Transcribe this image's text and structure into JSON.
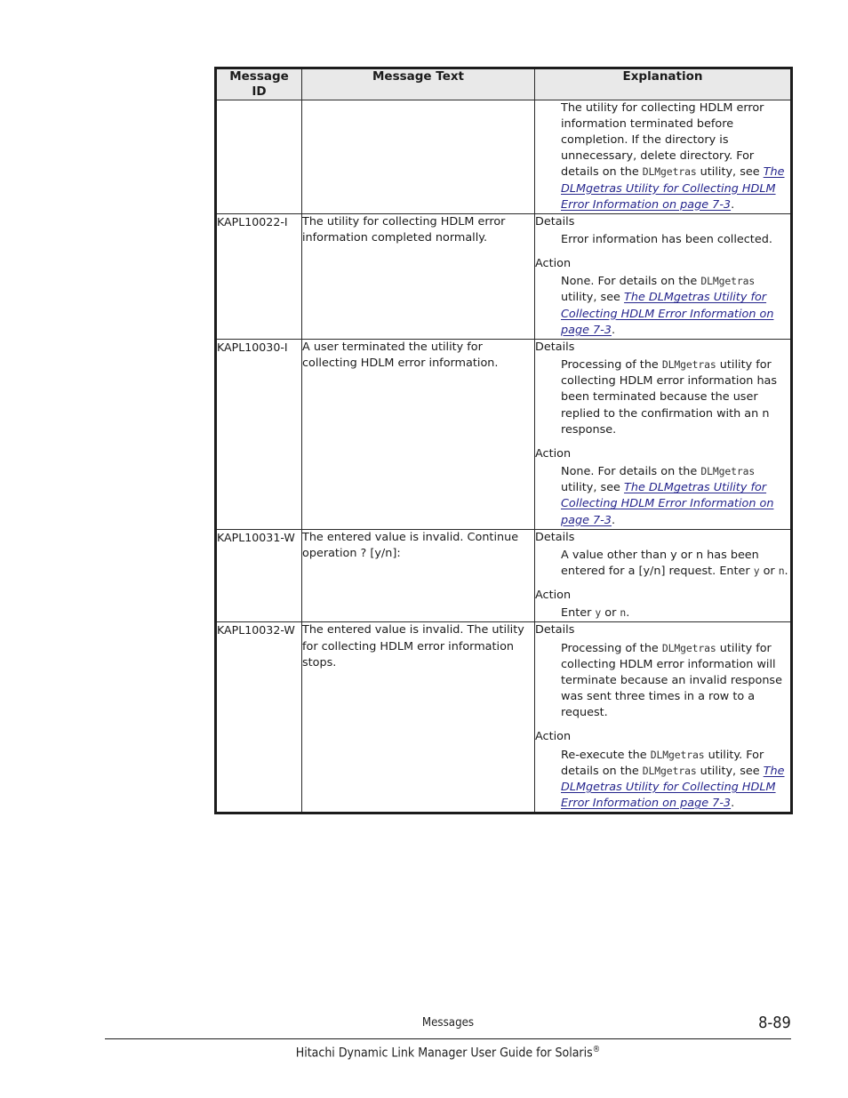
{
  "page": {
    "table": {
      "headers": {
        "id": "Message\nID",
        "id_line1": "Message",
        "id_line2": "ID",
        "text": "Message Text",
        "explanation": "Explanation"
      },
      "rows": [
        {
          "id": "",
          "message_text": "",
          "explanation": {
            "continued_body": "The utility for collecting HDLM error information terminated before completion. If the directory is unnecessary, delete directory. For details on the ",
            "mono1": "DLMgetras",
            "mid1": " utility, see ",
            "link1": "The DLMgetras Utility for Collecting HDLM Error Information on page 7-3",
            "tail1": "."
          }
        },
        {
          "id": "KAPL10022-I",
          "message_text": "The utility for collecting HDLM error information completed normally.",
          "explanation": {
            "details_label": "Details",
            "details_body": "Error information has been collected.",
            "action_label": "Action",
            "action_pre": "None. For details on the ",
            "action_mono": "DLMgetras",
            "action_mid": " utility, see ",
            "action_link": "The DLMgetras Utility for Collecting HDLM Error Information on page 7-3",
            "action_tail": "."
          }
        },
        {
          "id": "KAPL10030-I",
          "message_text": "A user terminated the utility for collecting HDLM error information.",
          "explanation": {
            "details_label": "Details",
            "details_pre": "Processing of the ",
            "details_mono": "DLMgetras",
            "details_post": " utility for collecting HDLM error information has been terminated because the user replied to the confirmation with an n response.",
            "action_label": "Action",
            "action_pre": "None. For details on the ",
            "action_mono": "DLMgetras",
            "action_mid": " utility, see ",
            "action_link": "The DLMgetras Utility for Collecting HDLM Error Information on page 7-3",
            "action_tail": "."
          }
        },
        {
          "id": "KAPL10031-W",
          "message_text": "The entered value is invalid. Continue operation ? [y/n]:",
          "explanation": {
            "details_label": "Details",
            "details_pre": "A value other than y or n has been entered for a [y/n] request. Enter ",
            "details_mono_y": "y",
            "details_or": " or ",
            "details_mono_n": "n",
            "details_tail": ".",
            "action_label": "Action",
            "action_pre": "Enter ",
            "action_mono_y": "y",
            "action_or": " or ",
            "action_mono_n": "n",
            "action_tail": "."
          }
        },
        {
          "id": "KAPL10032-W",
          "message_text": "The entered value is invalid. The utility for collecting HDLM error information stops.",
          "explanation": {
            "details_label": "Details",
            "details_pre": "Processing of the ",
            "details_mono": "DLMgetras",
            "details_post": " utility for collecting HDLM error information will terminate because an invalid response was sent three times in a row to a request.",
            "action_label": "Action",
            "action_pre": "Re-execute the ",
            "action_mono1": "DLMgetras",
            "action_mid1": " utility. For details on the ",
            "action_mono2": "DLMgetras",
            "action_mid2": " utility, see ",
            "action_link": "The DLMgetras Utility for Collecting HDLM Error Information on page 7-3",
            "action_tail": "."
          }
        }
      ]
    },
    "footer": {
      "section": "Messages",
      "page_number": "8-89",
      "book_title": "Hitachi Dynamic Link Manager User Guide for Solaris",
      "book_title_mark": "®"
    },
    "colors": {
      "header_background": "#e9e9e9",
      "link": "#25258c",
      "text": "#1a1a1a",
      "border": "#1c1c1c"
    }
  }
}
